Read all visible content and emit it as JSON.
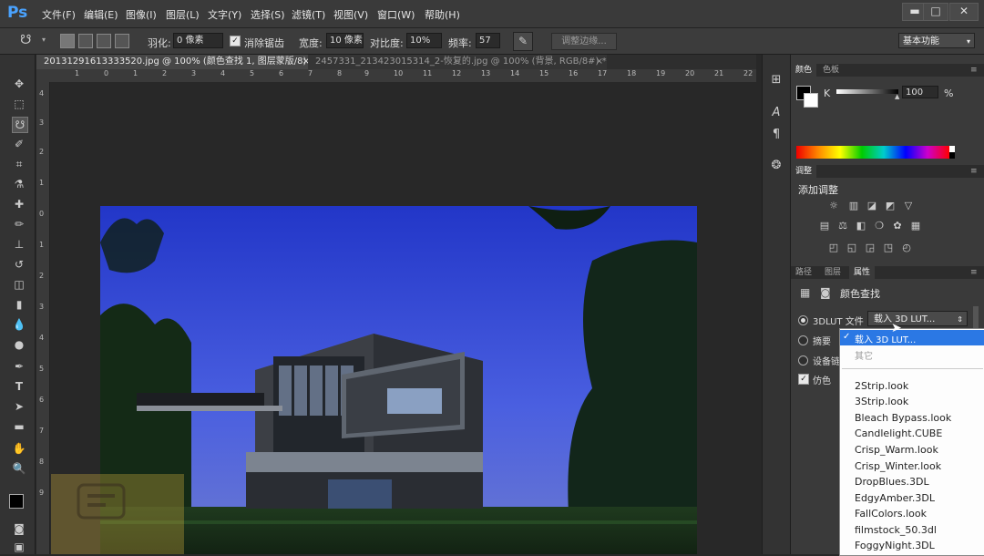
{
  "app": {
    "logo": "Ps"
  },
  "menubar": {
    "items": [
      "文件(F)",
      "编辑(E)",
      "图像(I)",
      "图层(L)",
      "文字(Y)",
      "选择(S)",
      "滤镜(T)",
      "视图(V)",
      "窗口(W)",
      "帮助(H)"
    ],
    "window_controls": [
      "▬",
      "□",
      "✕"
    ]
  },
  "options": {
    "feather_label": "羽化:",
    "feather_value": "0 像素",
    "antialias_label": "消除锯齿",
    "width_label": "宽度:",
    "width_value": "10 像素",
    "contrast_label": "对比度:",
    "contrast_value": "10%",
    "frequency_label": "频率:",
    "frequency_value": "57",
    "refine_edge_label": "调整边缘...",
    "workspace_value": "基本功能"
  },
  "tabs": [
    {
      "label": "20131291613333520.jpg @ 100% (颜色查找 1, 图层蒙版/8) *",
      "close": "×"
    },
    {
      "label": "2457331_213423015314_2-恢复的.jpg @ 100% (背景, RGB/8#) *",
      "close": "×"
    }
  ],
  "ruler": {
    "h_ticks": [
      "1",
      "0",
      "1",
      "2",
      "3",
      "4",
      "5",
      "6",
      "7",
      "8",
      "9",
      "10",
      "11",
      "12",
      "13",
      "14",
      "15",
      "16",
      "17",
      "18",
      "19",
      "20",
      "21",
      "22"
    ],
    "v_ticks": [
      "4",
      "3",
      "2",
      "1",
      "0",
      "1",
      "2",
      "3",
      "4",
      "5",
      "6",
      "7",
      "8",
      "9"
    ]
  },
  "color_panel": {
    "tabs": [
      "颜色",
      "色板"
    ],
    "channel_label": "K",
    "channel_value": "100",
    "unit": "%",
    "colors": {
      "foreground": "#000000",
      "background": "#ffffff"
    }
  },
  "adjustments_panel": {
    "tab": "调整",
    "title": "添加调整",
    "icons_row1": [
      "☼",
      "▥",
      "◪",
      "◩",
      "▽"
    ],
    "icons_row2": [
      "▤",
      "⚖",
      "◧",
      "❍",
      "✿",
      "▦"
    ],
    "icons_row3": [
      "◰",
      "◱",
      "◲",
      "◳",
      "◴"
    ]
  },
  "properties_panel": {
    "tabs": [
      "路径",
      "图层",
      "属性"
    ],
    "title": "颜色查找",
    "rows": [
      {
        "label": "3DLUT 文件",
        "selected": true
      },
      {
        "label": "摘要",
        "selected": false
      },
      {
        "label": "设备链",
        "selected": false
      }
    ],
    "dither_label": "仿色",
    "dropdown_value": "载入 3D LUT..."
  },
  "dropdown": {
    "highlighted": "载入 3D LUT...",
    "other": "其它",
    "check": "✓",
    "items": [
      "2Strip.look",
      "3Strip.look",
      "Bleach Bypass.look",
      "Candlelight.CUBE",
      "Crisp_Warm.look",
      "Crisp_Winter.look",
      "DropBlues.3DL",
      "EdgyAmber.3DL",
      "FallColors.look",
      "filmstock_50.3dl",
      "FoggyNight.3DL"
    ]
  }
}
